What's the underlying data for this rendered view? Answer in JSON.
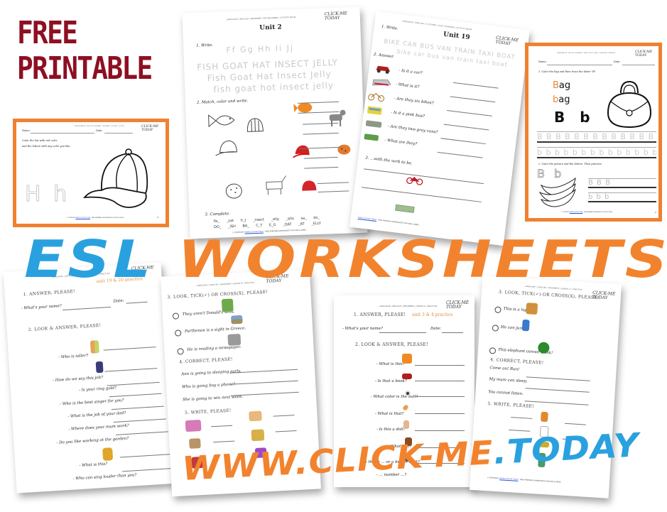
{
  "headline": {
    "free_line1": "FREE",
    "free_line2": "PRINTABLE",
    "esl_word1": "ESL",
    "esl_word2": "WORKSHEETS",
    "url_part1": "WWW.CLICK-ME",
    "url_part2": ".TODAY",
    "colors": {
      "dark_red": "#8e0f22",
      "blue": "#2aa1df",
      "orange": "#f2832e"
    }
  },
  "common": {
    "logo_line1": "CLICK-ME",
    "logo_line2": "TODAY",
    "name_label": "Name:",
    "date_label": "Date:",
    "footer_prefix": "© COPYRIGHT",
    "footer_link": "WWW.CLICK-ME.TODAY",
    "footer_suffix": "- FREE PRINTABLE WORKSHEETS FOR KIDS & MORE..."
  },
  "worksheet_hat": {
    "header": "KINDERGARTEN | ENGLISH | ALPHABET | ALPHABET COLORING | LETTER",
    "instruction_line1": "Color the hat with red color",
    "instruction_line2": "and the letters with any color you like.",
    "letters": "H h",
    "picture": "baseball-cap",
    "page_number": "2"
  },
  "worksheet_unit2": {
    "header": "LANGUAGE | ENGLISH | BEGINNER | PRE-BEGINNER | ACTIVITY BOOK",
    "title": "Unit 2",
    "section1": "1. Write.",
    "trace_letters": "Ff  Gg  Hh  Ii  Jj",
    "trace_upper": "FISH  GOAT  HAT  INSECT  JELLY",
    "trace_title": "Fish  Goat  Hat  Insect  Jelly",
    "trace_lower": "fish  goat  hot  insect  jelly",
    "section2": "2. Match, color and write.",
    "section3": "3. Complete.",
    "complete_row1": [
      "fis_",
      "_oat",
      "h_t",
      "_nsect",
      "_elly",
      "_ello",
      "sa_",
      "do_"
    ],
    "complete_row2": [
      "DO_",
      "_ISH",
      "BA_",
      "C_T",
      "E_G",
      "_OAT",
      "_AT",
      "_ELLY"
    ]
  },
  "worksheet_unit19": {
    "header": "LANGUAGE | ENGLISH | A COURSE | EASY LEARNING | ACTIVITY BOOK",
    "title": "Unit 19",
    "section1": "1. Write.",
    "trace_upper": "BIKE  CAR  BUS  VAN  TRAIN  TAXI  BOAT",
    "trace_lower": "bike  car  bus  van  train  taxi  boat",
    "section2": "2. Answer.",
    "questions": [
      "- Is it a car?",
      "- What is it?",
      "- Are they six bikes?",
      "- Is it a pink bus?",
      "- Are they two gray vans?",
      "- What are they?"
    ],
    "section3": "3. ...with the verb to be."
  },
  "worksheet_bag": {
    "header": "KINDERGARTEN | ENGLISH | ALPHABET | PRACTICING LETTERS | UPPERCASE LOWERCASE",
    "instruction1": "1. Color the bag and then trace the letter \"B\".",
    "word_upper": "Bag",
    "word_lower": "bag",
    "letters": "B b",
    "trace_upper_row": "B B B B B B B B B B B B B B",
    "trace_lower_row": "b b b b b b b b b b b b b b",
    "instruction2": "2. Color the picture and the letters. Then practice.",
    "small_trace_upper": "B B B",
    "small_trace_lower": "b b b",
    "page_number": "2"
  },
  "worksheet_unit19_20": {
    "header": "LANGUAGE | ENGLISH | BEGINNER | JUNIOR B | PRACTICE",
    "subtitle": "unit 19 & 20 practice",
    "section1": "1. ANSWER, PLEASE!",
    "name_question": "- What's your name?",
    "section2": "2. LOOK & ANSWER, PLEASE!",
    "questions": [
      "- Who is taller?",
      "- How do we say this job?",
      "- Is your ring gold?",
      "- Who is the best singer for you?",
      "- What is the job of your dad?",
      "- Where does your mum work?",
      "- Do you like working at the garden?",
      "- What is this?",
      "- Who can sing louder than you?"
    ]
  },
  "worksheet_tick_cross_1": {
    "header": "LANGUAGE | ENGLISH | BEGINNER | JUNIOR B | PRACTICE",
    "section3": "3. LOOK, TICK(✓) OR CROSS(X), PLEASE!",
    "statements": [
      "They aren't Donald's sons.",
      "Parthenon is a sight in Greece.",
      "He is reading a newspaper."
    ],
    "section4": "4. CORRECT, PLEASE!",
    "corrections": [
      "Ann is going to sleeping early.",
      "Who is going buy a phone?",
      "She is going to win next week."
    ],
    "section5": "5. WRITE, PLEASE!"
  },
  "worksheet_unit3_4": {
    "header": "LANGUAGE | ENGLISH | BEGINNER | JUNIOR A | PRACTICE",
    "subtitle": "unit 3 & 4 practice",
    "section1": "1. ANSWER, PLEASE!",
    "name_question": "- What's your name?",
    "section2": "2. LOOK & ANSWER, PLEASE!",
    "questions": [
      "- What is this?",
      "- Is that a book?",
      "- What color is the ball?",
      "- What is that?",
      "- Is this a doll?",
      "- What is it?",
      "- Is that a ... or a brown boat?",
      "- ... number ...?"
    ]
  },
  "worksheet_tick_cross_2": {
    "header": "LANGUAGE | ENGLISH | BEGINNER | JUNIOR A | PRACTICE",
    "section3": "3. LOOK, TICK(✓) OR CROSS(X), PLEASE!",
    "statements": [
      "This is a tiger.",
      "He can jump.",
      "This elephant cannot drink!"
    ],
    "section4": "4. CORRECT, PLEASE!",
    "corrections": [
      "Come on! Run!",
      "My mum can sleep.",
      "You cannot listen."
    ],
    "section5": "5. WRITE, PLEASE!"
  }
}
